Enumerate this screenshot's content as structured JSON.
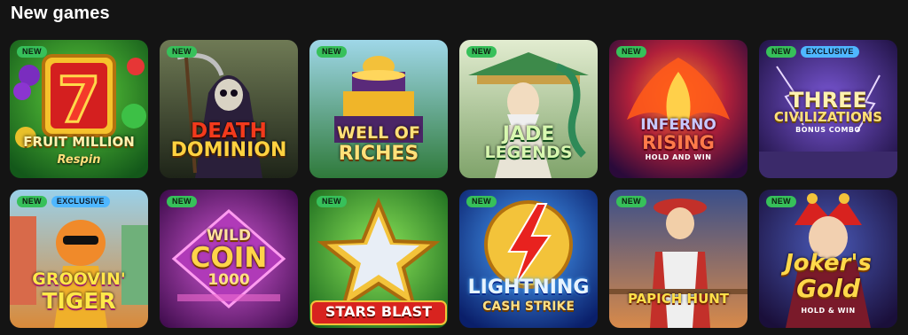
{
  "section": {
    "title": "New games"
  },
  "badges": {
    "new": "NEW",
    "exclusive": "EXCLUSIVE"
  },
  "games": [
    {
      "name": "Fruit Million Respin",
      "title": "FRUIT MILLION",
      "subtitle": "Respin",
      "badges": [
        "NEW"
      ],
      "accent": "#2f9b2a"
    },
    {
      "name": "Death Dominion",
      "title": "DEATH",
      "title2": "DOMINION",
      "badges": [
        "NEW"
      ],
      "accent": "#4a5a3a"
    },
    {
      "name": "Well of Riches",
      "title": "WELL OF",
      "title2": "RICHES",
      "badges": [
        "NEW"
      ],
      "accent": "#1f6b2e"
    },
    {
      "name": "Jade Legends",
      "title": "JADE",
      "title2": "LEGENDS",
      "badges": [
        "NEW"
      ],
      "accent": "#b9c9a5"
    },
    {
      "name": "Inferno Rising Hold and Win",
      "title": "INFERNO",
      "title2": "RISING",
      "subtitle": "HOLD AND WIN",
      "badges": [
        "NEW"
      ],
      "accent": "#7a1038"
    },
    {
      "name": "Three Civilizations Bonus Combo",
      "title": "THREE",
      "title2": "CIVILIZATIONS",
      "subtitle": "BONUS COMBO",
      "badges": [
        "NEW",
        "EXCLUSIVE"
      ],
      "accent": "#3a1d6e"
    },
    {
      "name": "Groovin' Tiger",
      "title": "GROOVIN'",
      "title2": "TIGER",
      "badges": [
        "NEW",
        "EXCLUSIVE"
      ],
      "accent": "#c9a56a"
    },
    {
      "name": "Wild Coin 1000",
      "title": "WILD",
      "title2": "COIN",
      "subtitle": "1000",
      "badges": [
        "NEW"
      ],
      "accent": "#7a1e8c"
    },
    {
      "name": "Stars Blast",
      "title": "STARS BLAST",
      "badges": [
        "NEW"
      ],
      "accent": "#2c9b32"
    },
    {
      "name": "Lightning Cash Strike",
      "title": "LIGHTNING",
      "subtitle": "CASH STRIKE",
      "badges": [
        "NEW"
      ],
      "accent": "#1d4fbf"
    },
    {
      "name": "Papich Hunt",
      "title": "PAPICH HUNT",
      "badges": [
        "NEW"
      ],
      "accent": "#3d4a7a"
    },
    {
      "name": "Joker's Gold Hold & Win",
      "title": "Joker's",
      "title2": "Gold",
      "subtitle": "HOLD & WIN",
      "badges": [
        "NEW"
      ],
      "accent": "#3b1f5a"
    }
  ]
}
